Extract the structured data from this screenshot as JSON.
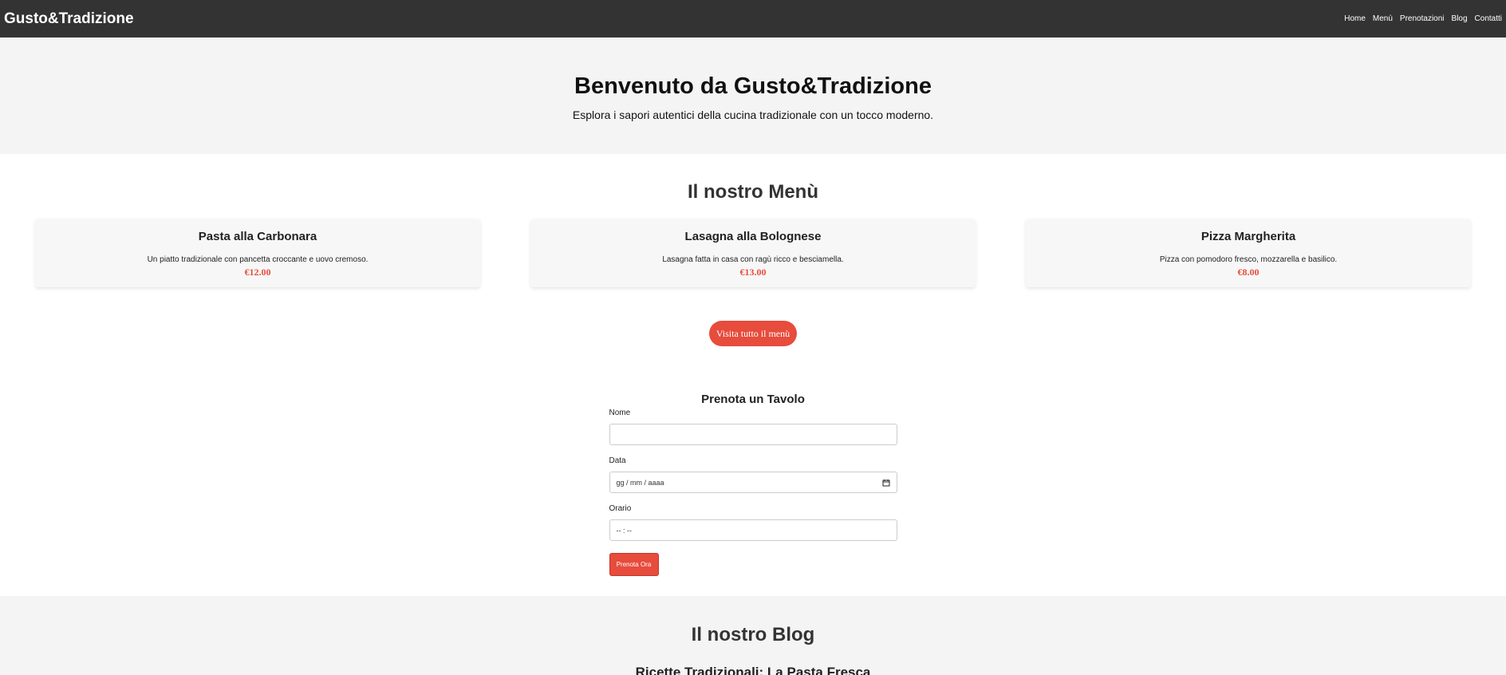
{
  "nav": {
    "brand": "Gusto&Tradizione",
    "links": [
      "Home",
      "Menù",
      "Prenotazioni",
      "Blog",
      "Contatti"
    ]
  },
  "hero": {
    "title": "Benvenuto da Gusto&Tradizione",
    "subtitle": "Esplora i sapori autentici della cucina tradizionale con un tocco moderno."
  },
  "menu": {
    "title": "Il nostro Menù",
    "items": [
      {
        "name": "Pasta alla Carbonara",
        "description": "Un piatto tradizionale con pancetta croccante e uovo cremoso.",
        "price": "€12.00"
      },
      {
        "name": "Lasagna alla Bolognese",
        "description": "Lasagna fatta in casa con ragù ricco e besciamella.",
        "price": "€13.00"
      },
      {
        "name": "Pizza Margherita",
        "description": "Pizza con pomodoro fresco, mozzarella e basilico.",
        "price": "€8.00"
      }
    ],
    "button_label": "Visita tutto il menù"
  },
  "booking": {
    "title": "Prenota un Tavolo",
    "name_label": "Nome",
    "name_value": "",
    "date_label": "Data",
    "date_placeholder": "gg / mm / aaaa",
    "time_label": "Orario",
    "time_placeholder": "-- : --",
    "submit_label": "Prenota Ora"
  },
  "blog": {
    "title": "Il nostro Blog",
    "first_article": "Ricette Tradizionali: La Pasta Fresca"
  },
  "colors": {
    "accent": "#e74c3c",
    "navbar": "#333333",
    "hero_bg": "#f4f4f4"
  }
}
